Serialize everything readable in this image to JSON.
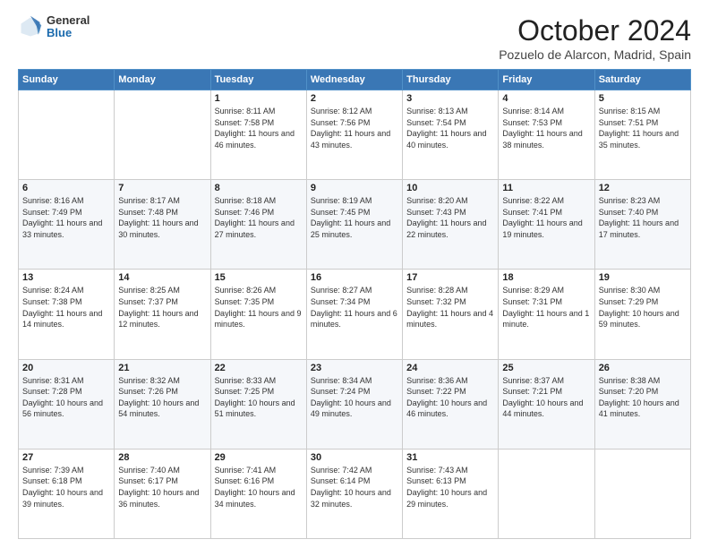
{
  "header": {
    "logo_general": "General",
    "logo_blue": "Blue",
    "month_title": "October 2024",
    "location": "Pozuelo de Alarcon, Madrid, Spain"
  },
  "weekdays": [
    "Sunday",
    "Monday",
    "Tuesday",
    "Wednesday",
    "Thursday",
    "Friday",
    "Saturday"
  ],
  "weeks": [
    [
      {
        "day": "",
        "info": ""
      },
      {
        "day": "",
        "info": ""
      },
      {
        "day": "1",
        "info": "Sunrise: 8:11 AM\nSunset: 7:58 PM\nDaylight: 11 hours and 46 minutes."
      },
      {
        "day": "2",
        "info": "Sunrise: 8:12 AM\nSunset: 7:56 PM\nDaylight: 11 hours and 43 minutes."
      },
      {
        "day": "3",
        "info": "Sunrise: 8:13 AM\nSunset: 7:54 PM\nDaylight: 11 hours and 40 minutes."
      },
      {
        "day": "4",
        "info": "Sunrise: 8:14 AM\nSunset: 7:53 PM\nDaylight: 11 hours and 38 minutes."
      },
      {
        "day": "5",
        "info": "Sunrise: 8:15 AM\nSunset: 7:51 PM\nDaylight: 11 hours and 35 minutes."
      }
    ],
    [
      {
        "day": "6",
        "info": "Sunrise: 8:16 AM\nSunset: 7:49 PM\nDaylight: 11 hours and 33 minutes."
      },
      {
        "day": "7",
        "info": "Sunrise: 8:17 AM\nSunset: 7:48 PM\nDaylight: 11 hours and 30 minutes."
      },
      {
        "day": "8",
        "info": "Sunrise: 8:18 AM\nSunset: 7:46 PM\nDaylight: 11 hours and 27 minutes."
      },
      {
        "day": "9",
        "info": "Sunrise: 8:19 AM\nSunset: 7:45 PM\nDaylight: 11 hours and 25 minutes."
      },
      {
        "day": "10",
        "info": "Sunrise: 8:20 AM\nSunset: 7:43 PM\nDaylight: 11 hours and 22 minutes."
      },
      {
        "day": "11",
        "info": "Sunrise: 8:22 AM\nSunset: 7:41 PM\nDaylight: 11 hours and 19 minutes."
      },
      {
        "day": "12",
        "info": "Sunrise: 8:23 AM\nSunset: 7:40 PM\nDaylight: 11 hours and 17 minutes."
      }
    ],
    [
      {
        "day": "13",
        "info": "Sunrise: 8:24 AM\nSunset: 7:38 PM\nDaylight: 11 hours and 14 minutes."
      },
      {
        "day": "14",
        "info": "Sunrise: 8:25 AM\nSunset: 7:37 PM\nDaylight: 11 hours and 12 minutes."
      },
      {
        "day": "15",
        "info": "Sunrise: 8:26 AM\nSunset: 7:35 PM\nDaylight: 11 hours and 9 minutes."
      },
      {
        "day": "16",
        "info": "Sunrise: 8:27 AM\nSunset: 7:34 PM\nDaylight: 11 hours and 6 minutes."
      },
      {
        "day": "17",
        "info": "Sunrise: 8:28 AM\nSunset: 7:32 PM\nDaylight: 11 hours and 4 minutes."
      },
      {
        "day": "18",
        "info": "Sunrise: 8:29 AM\nSunset: 7:31 PM\nDaylight: 11 hours and 1 minute."
      },
      {
        "day": "19",
        "info": "Sunrise: 8:30 AM\nSunset: 7:29 PM\nDaylight: 10 hours and 59 minutes."
      }
    ],
    [
      {
        "day": "20",
        "info": "Sunrise: 8:31 AM\nSunset: 7:28 PM\nDaylight: 10 hours and 56 minutes."
      },
      {
        "day": "21",
        "info": "Sunrise: 8:32 AM\nSunset: 7:26 PM\nDaylight: 10 hours and 54 minutes."
      },
      {
        "day": "22",
        "info": "Sunrise: 8:33 AM\nSunset: 7:25 PM\nDaylight: 10 hours and 51 minutes."
      },
      {
        "day": "23",
        "info": "Sunrise: 8:34 AM\nSunset: 7:24 PM\nDaylight: 10 hours and 49 minutes."
      },
      {
        "day": "24",
        "info": "Sunrise: 8:36 AM\nSunset: 7:22 PM\nDaylight: 10 hours and 46 minutes."
      },
      {
        "day": "25",
        "info": "Sunrise: 8:37 AM\nSunset: 7:21 PM\nDaylight: 10 hours and 44 minutes."
      },
      {
        "day": "26",
        "info": "Sunrise: 8:38 AM\nSunset: 7:20 PM\nDaylight: 10 hours and 41 minutes."
      }
    ],
    [
      {
        "day": "27",
        "info": "Sunrise: 7:39 AM\nSunset: 6:18 PM\nDaylight: 10 hours and 39 minutes."
      },
      {
        "day": "28",
        "info": "Sunrise: 7:40 AM\nSunset: 6:17 PM\nDaylight: 10 hours and 36 minutes."
      },
      {
        "day": "29",
        "info": "Sunrise: 7:41 AM\nSunset: 6:16 PM\nDaylight: 10 hours and 34 minutes."
      },
      {
        "day": "30",
        "info": "Sunrise: 7:42 AM\nSunset: 6:14 PM\nDaylight: 10 hours and 32 minutes."
      },
      {
        "day": "31",
        "info": "Sunrise: 7:43 AM\nSunset: 6:13 PM\nDaylight: 10 hours and 29 minutes."
      },
      {
        "day": "",
        "info": ""
      },
      {
        "day": "",
        "info": ""
      }
    ]
  ]
}
